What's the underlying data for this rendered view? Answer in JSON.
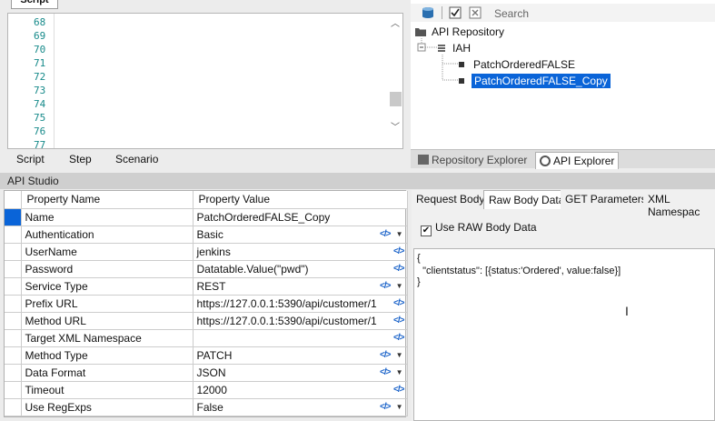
{
  "script_panel": {
    "tab": "Script",
    "line_numbers": [
      "68",
      "69",
      "70",
      "71",
      "72",
      "73",
      "74",
      "75",
      "76",
      "77"
    ],
    "bottom_tabs": [
      "Script",
      "Step",
      "Scenario"
    ]
  },
  "explorer": {
    "search_placeholder": "Search",
    "tree": {
      "root": "API Repository",
      "group": "IAH",
      "items": [
        "PatchOrderedFALSE",
        "PatchOrderedFALSE_Copy"
      ]
    },
    "tabs": [
      "Repository Explorer",
      "API Explorer"
    ],
    "active_tab": "API Explorer"
  },
  "studio": {
    "title": "API Studio",
    "columns": [
      "Property Name",
      "Property Value"
    ],
    "rows": [
      {
        "name": "Name",
        "value": "PatchOrderedFALSE_Copy"
      },
      {
        "name": "Authentication",
        "value": "Basic"
      },
      {
        "name": "UserName",
        "value": "jenkins"
      },
      {
        "name": "Password",
        "value": "Datatable.Value(\"pwd\")"
      },
      {
        "name": "Service Type",
        "value": "REST"
      },
      {
        "name": "Prefix URL",
        "value": "https://127.0.0.1:5390/api/customer/1"
      },
      {
        "name": "Method URL",
        "value": "https://127.0.0.1:5390/api/customer/1"
      },
      {
        "name": "Target XML Namespace",
        "value": ""
      },
      {
        "name": "Method Type",
        "value": "PATCH"
      },
      {
        "name": "Data Format",
        "value": "JSON"
      },
      {
        "name": "Timeout",
        "value": "12000"
      },
      {
        "name": "Use RegExps",
        "value": "False"
      }
    ],
    "body_tabs": [
      "Request Body",
      "Raw Body Data",
      "GET Parameters",
      "XML Namespac"
    ],
    "active_body_tab": "Raw Body Data",
    "use_raw_label": "Use RAW Body Data",
    "use_raw_checked": "✔",
    "raw_body": {
      "open": "{",
      "line": "  \"clientstatus\": [{status:'Ordered', value:false}]",
      "close": "}"
    }
  },
  "icons": {
    "code": "</>",
    "dropdown": "▼",
    "scroll_up": "︿",
    "scroll_down": "﹀"
  }
}
